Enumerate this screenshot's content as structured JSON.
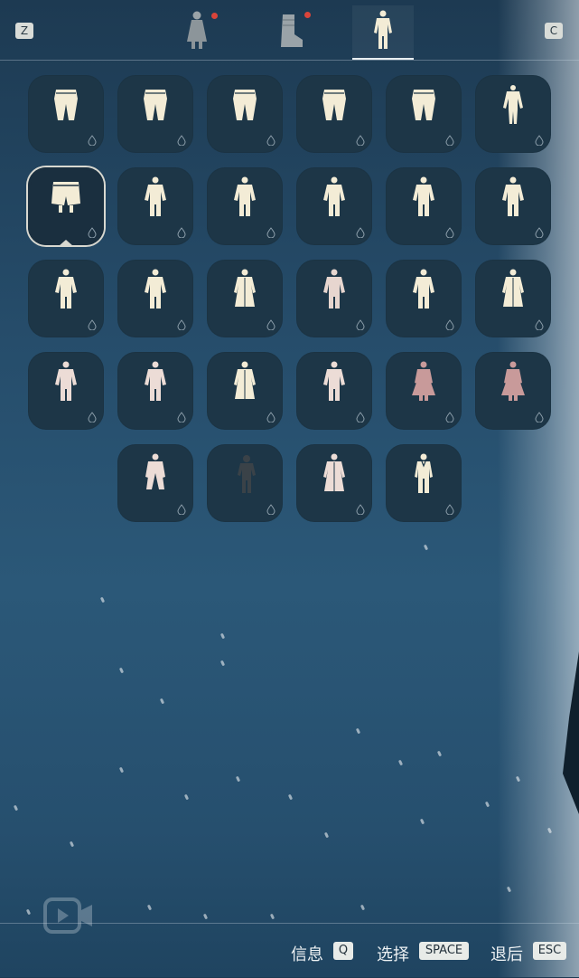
{
  "topbar": {
    "left_key": "Z",
    "right_key": "C",
    "tabs": [
      {
        "icon": "cape-icon",
        "notify": true,
        "active": false
      },
      {
        "icon": "boots-icon",
        "notify": true,
        "active": false
      },
      {
        "icon": "outfit-icon",
        "notify": false,
        "active": true
      }
    ]
  },
  "grid": {
    "selected_index": 6,
    "new_badge_index": 31,
    "items": [
      {
        "icon": "pants-icon",
        "color": "#f3ecd6"
      },
      {
        "icon": "pants-icon",
        "color": "#f3ecd6"
      },
      {
        "icon": "pants-icon",
        "color": "#f3ecd6"
      },
      {
        "icon": "pants-icon",
        "color": "#f3ecd6"
      },
      {
        "icon": "pants-icon",
        "color": "#f3ecd6"
      },
      {
        "icon": "bodysuit-icon",
        "color": "#f3ecd6"
      },
      {
        "icon": "shorts-icon",
        "color": "#f3ecd6"
      },
      {
        "icon": "outfit-icon",
        "color": "#f3ecd6"
      },
      {
        "icon": "outfit-icon",
        "color": "#f3ecd6"
      },
      {
        "icon": "outfit-icon",
        "color": "#f3ecd6"
      },
      {
        "icon": "outfit-icon",
        "color": "#f3ecd6"
      },
      {
        "icon": "outfit-icon",
        "color": "#f3ecd6"
      },
      {
        "icon": "outfit-icon",
        "color": "#f3ecd6"
      },
      {
        "icon": "outfit-icon",
        "color": "#f3ecd6"
      },
      {
        "icon": "robe-icon",
        "color": "#f3ecd6"
      },
      {
        "icon": "outfit-icon",
        "color": "#e7d6cf"
      },
      {
        "icon": "outfit-icon",
        "color": "#f3ecd6"
      },
      {
        "icon": "robe-icon",
        "color": "#f3ecd6"
      },
      {
        "icon": "outfit-icon",
        "color": "#ecdcd6"
      },
      {
        "icon": "outfit-icon",
        "color": "#ecdcd6"
      },
      {
        "icon": "robe-icon",
        "color": "#f3ecd6"
      },
      {
        "icon": "outfit-icon",
        "color": "#ecdcd6"
      },
      {
        "icon": "dress-icon",
        "color": "#c89a9a"
      },
      {
        "icon": "dress-icon",
        "color": "#c89a9a"
      },
      {
        "icon": "coat-icon",
        "color": "#ecdcd6"
      },
      {
        "icon": "ninja-outfit-icon",
        "color": "#3a4248"
      },
      {
        "icon": "robe-icon",
        "color": "#ecdcd6"
      },
      {
        "icon": "suit-icon",
        "color": "#f3ecd6"
      }
    ]
  },
  "bottombar": {
    "info_label": "信息",
    "info_key": "Q",
    "select_label": "选择",
    "select_key": "SPACE",
    "back_label": "退后",
    "back_key": "ESC"
  }
}
